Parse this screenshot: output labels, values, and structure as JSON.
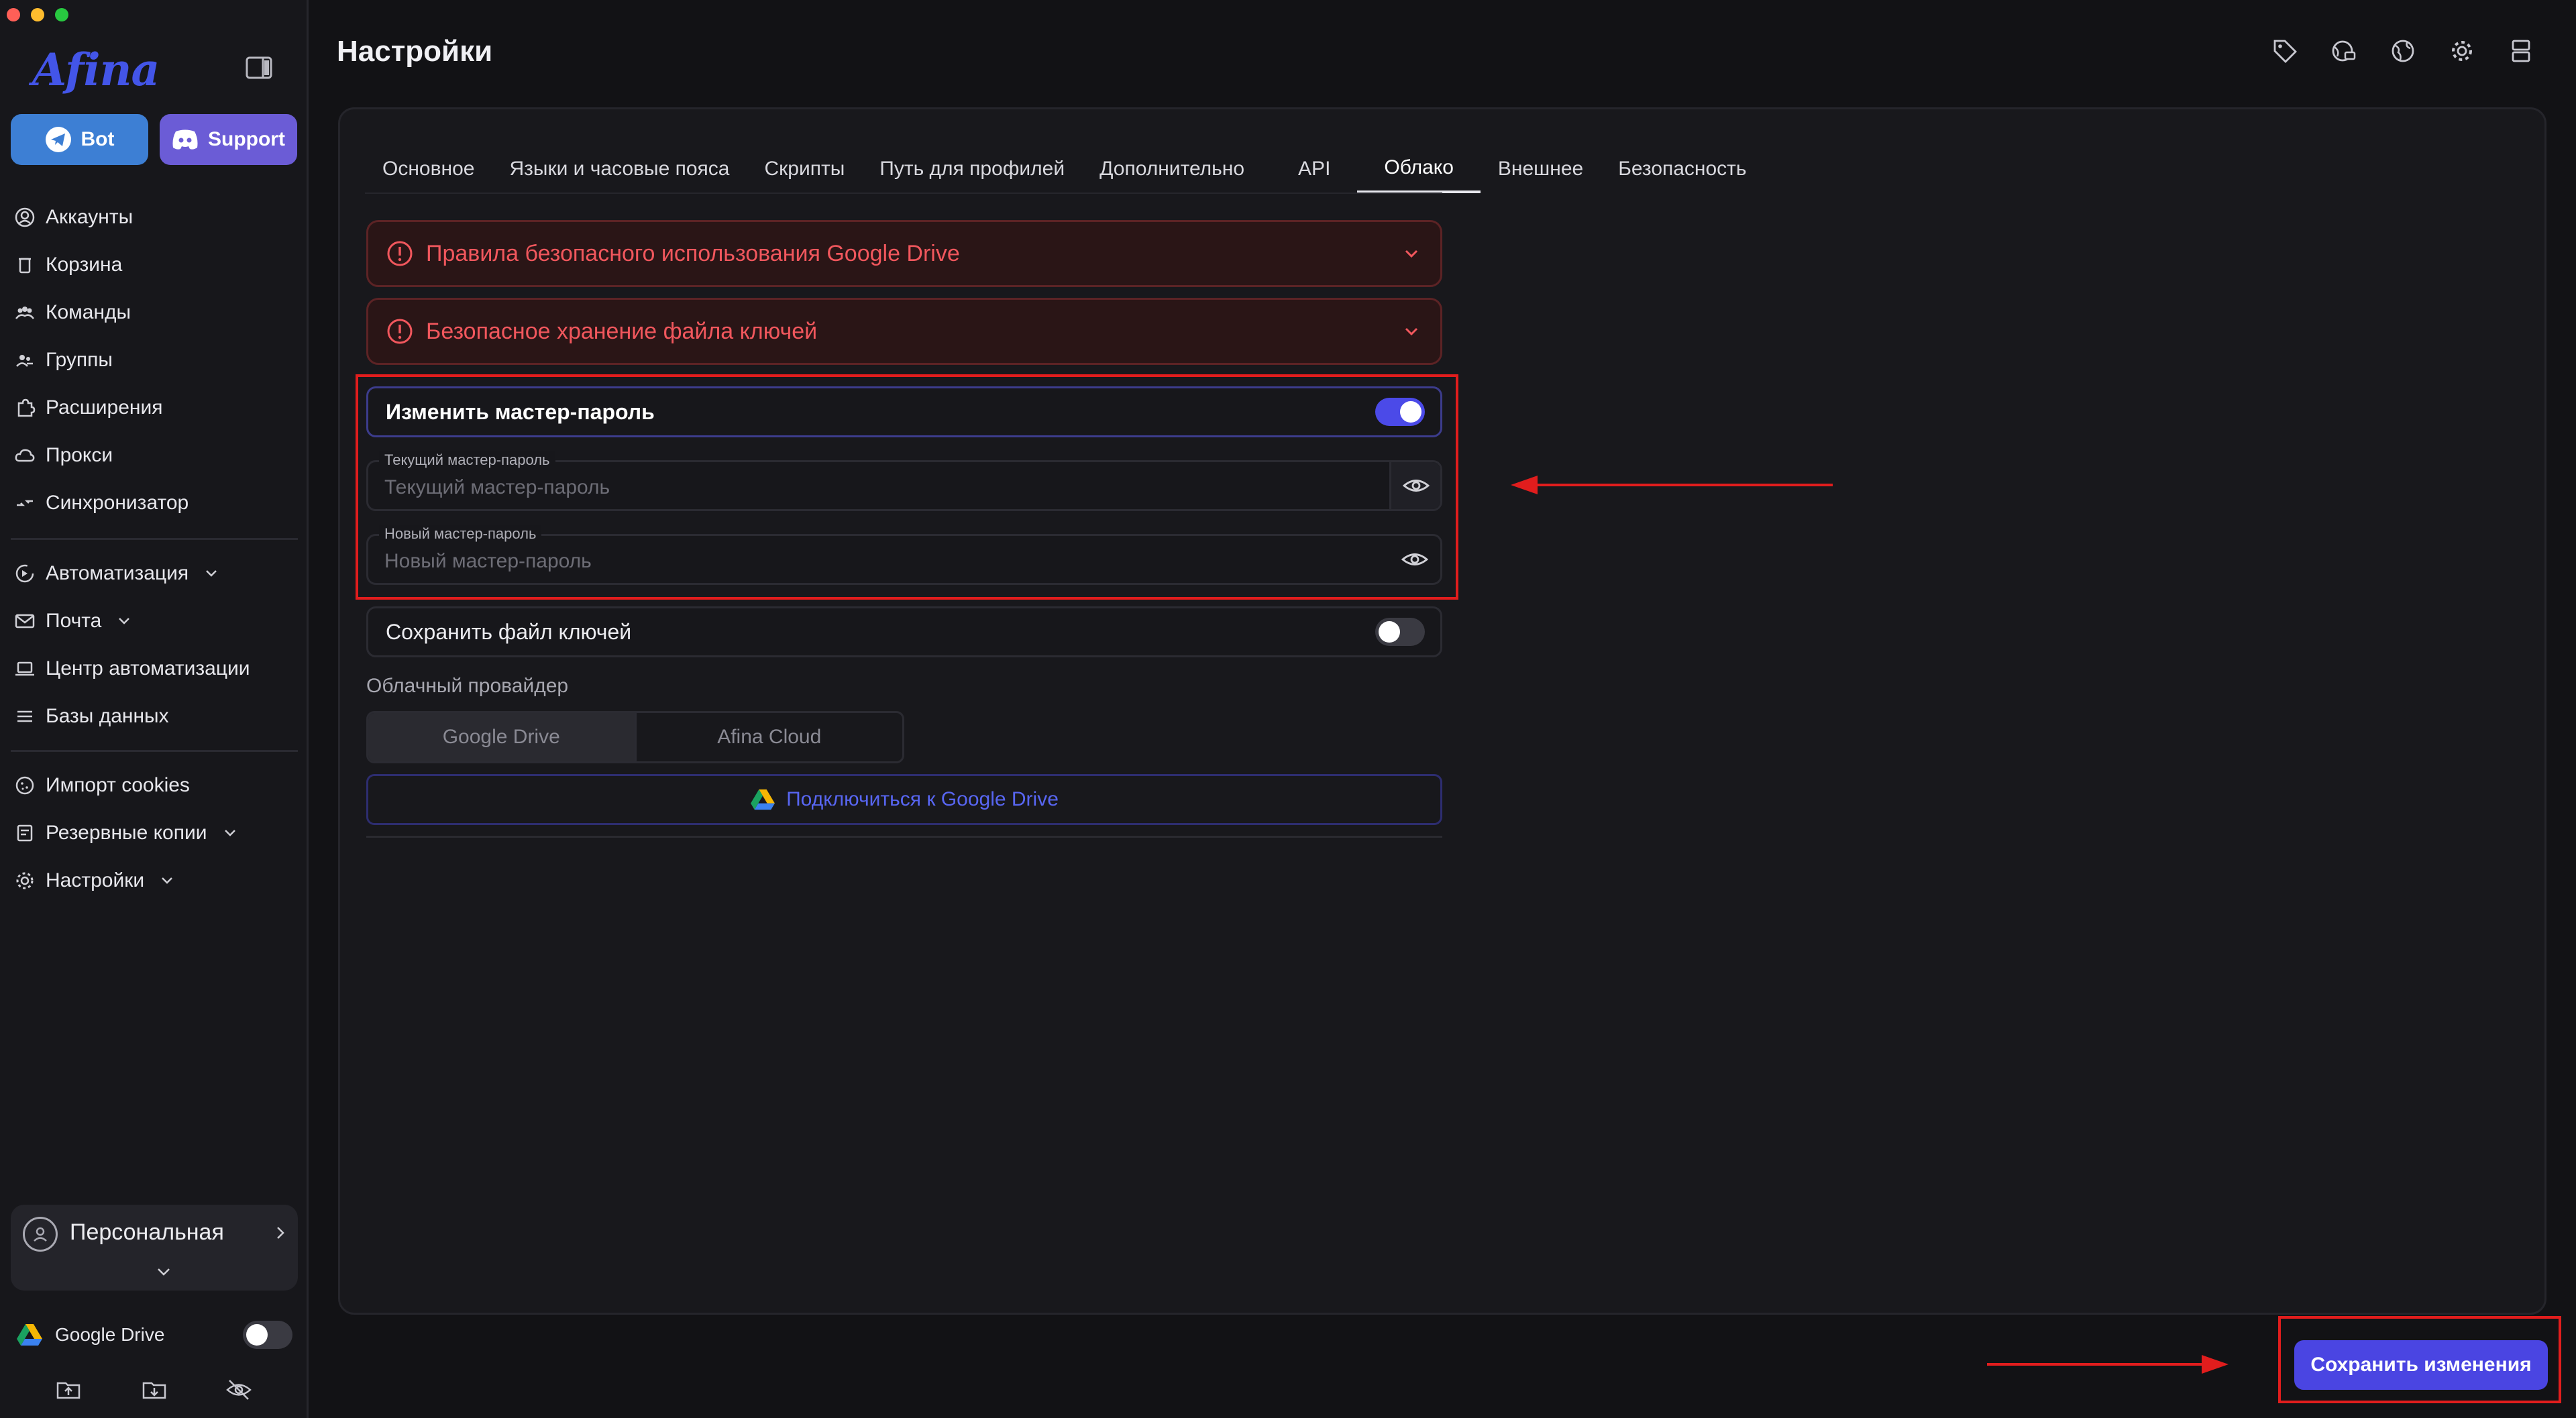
{
  "sidebar": {
    "logo_text": "Afina",
    "bot_label": "Bot",
    "support_label": "Support",
    "nav_main": [
      {
        "label": "Аккаунты",
        "icon": "user-circle-icon"
      },
      {
        "label": "Корзина",
        "icon": "trash-icon"
      },
      {
        "label": "Команды",
        "icon": "team-icon"
      },
      {
        "label": "Группы",
        "icon": "group-icon"
      },
      {
        "label": "Расширения",
        "icon": "puzzle-icon"
      },
      {
        "label": "Прокси",
        "icon": "cloud-icon"
      },
      {
        "label": "Синхронизатор",
        "icon": "sync-icon"
      }
    ],
    "nav_automation": [
      {
        "label": "Автоматизация",
        "icon": "automation-icon"
      },
      {
        "label": "Почта",
        "icon": "mail-icon"
      },
      {
        "label": "Центр автоматизации",
        "icon": "laptop-icon"
      },
      {
        "label": "Базы данных",
        "icon": "list-icon"
      }
    ],
    "nav_tools": [
      {
        "label": "Импорт cookies",
        "icon": "cookie-icon"
      },
      {
        "label": "Резервные копии",
        "icon": "backup-icon"
      },
      {
        "label": "Настройки",
        "icon": "gear-icon"
      }
    ],
    "profile_label": "Персональная",
    "google_drive_label": "Google Drive",
    "google_drive_enabled": false
  },
  "main": {
    "title": "Настройки",
    "tabs": [
      {
        "label": "Основное",
        "active": false
      },
      {
        "label": "Языки и часовые пояса",
        "active": false
      },
      {
        "label": "Скрипты",
        "active": false
      },
      {
        "label": "Путь для профилей",
        "active": false
      },
      {
        "label": "Дополнительно",
        "active": false
      },
      {
        "label": "API",
        "active": false
      },
      {
        "label": "Облако",
        "active": true
      },
      {
        "label": "Внешнее",
        "active": false
      },
      {
        "label": "Безопасность",
        "active": false
      }
    ],
    "alerts": [
      {
        "text": "Правила безопасного использования Google Drive"
      },
      {
        "text": "Безопасное хранение файла ключей"
      }
    ],
    "change_master_password": {
      "label": "Изменить мастер-пароль",
      "enabled": true
    },
    "current_password": {
      "label": "Текущий мастер-пароль",
      "placeholder": "Текущий мастер-пароль",
      "value": ""
    },
    "new_password": {
      "label": "Новый мастер-пароль",
      "placeholder": "Новый мастер-пароль",
      "value": ""
    },
    "save_keyfile": {
      "label": "Сохранить файл ключей",
      "enabled": false
    },
    "provider": {
      "label": "Облачный провайдер",
      "options": [
        "Google Drive",
        "Afina Cloud"
      ],
      "selected": "Google Drive"
    },
    "connect_label": "Подключиться к Google Drive",
    "save_label": "Сохранить изменения"
  },
  "colors": {
    "accent": "#4a45e2",
    "alert_text": "#f1575d",
    "annotation": "#e11d1d"
  }
}
